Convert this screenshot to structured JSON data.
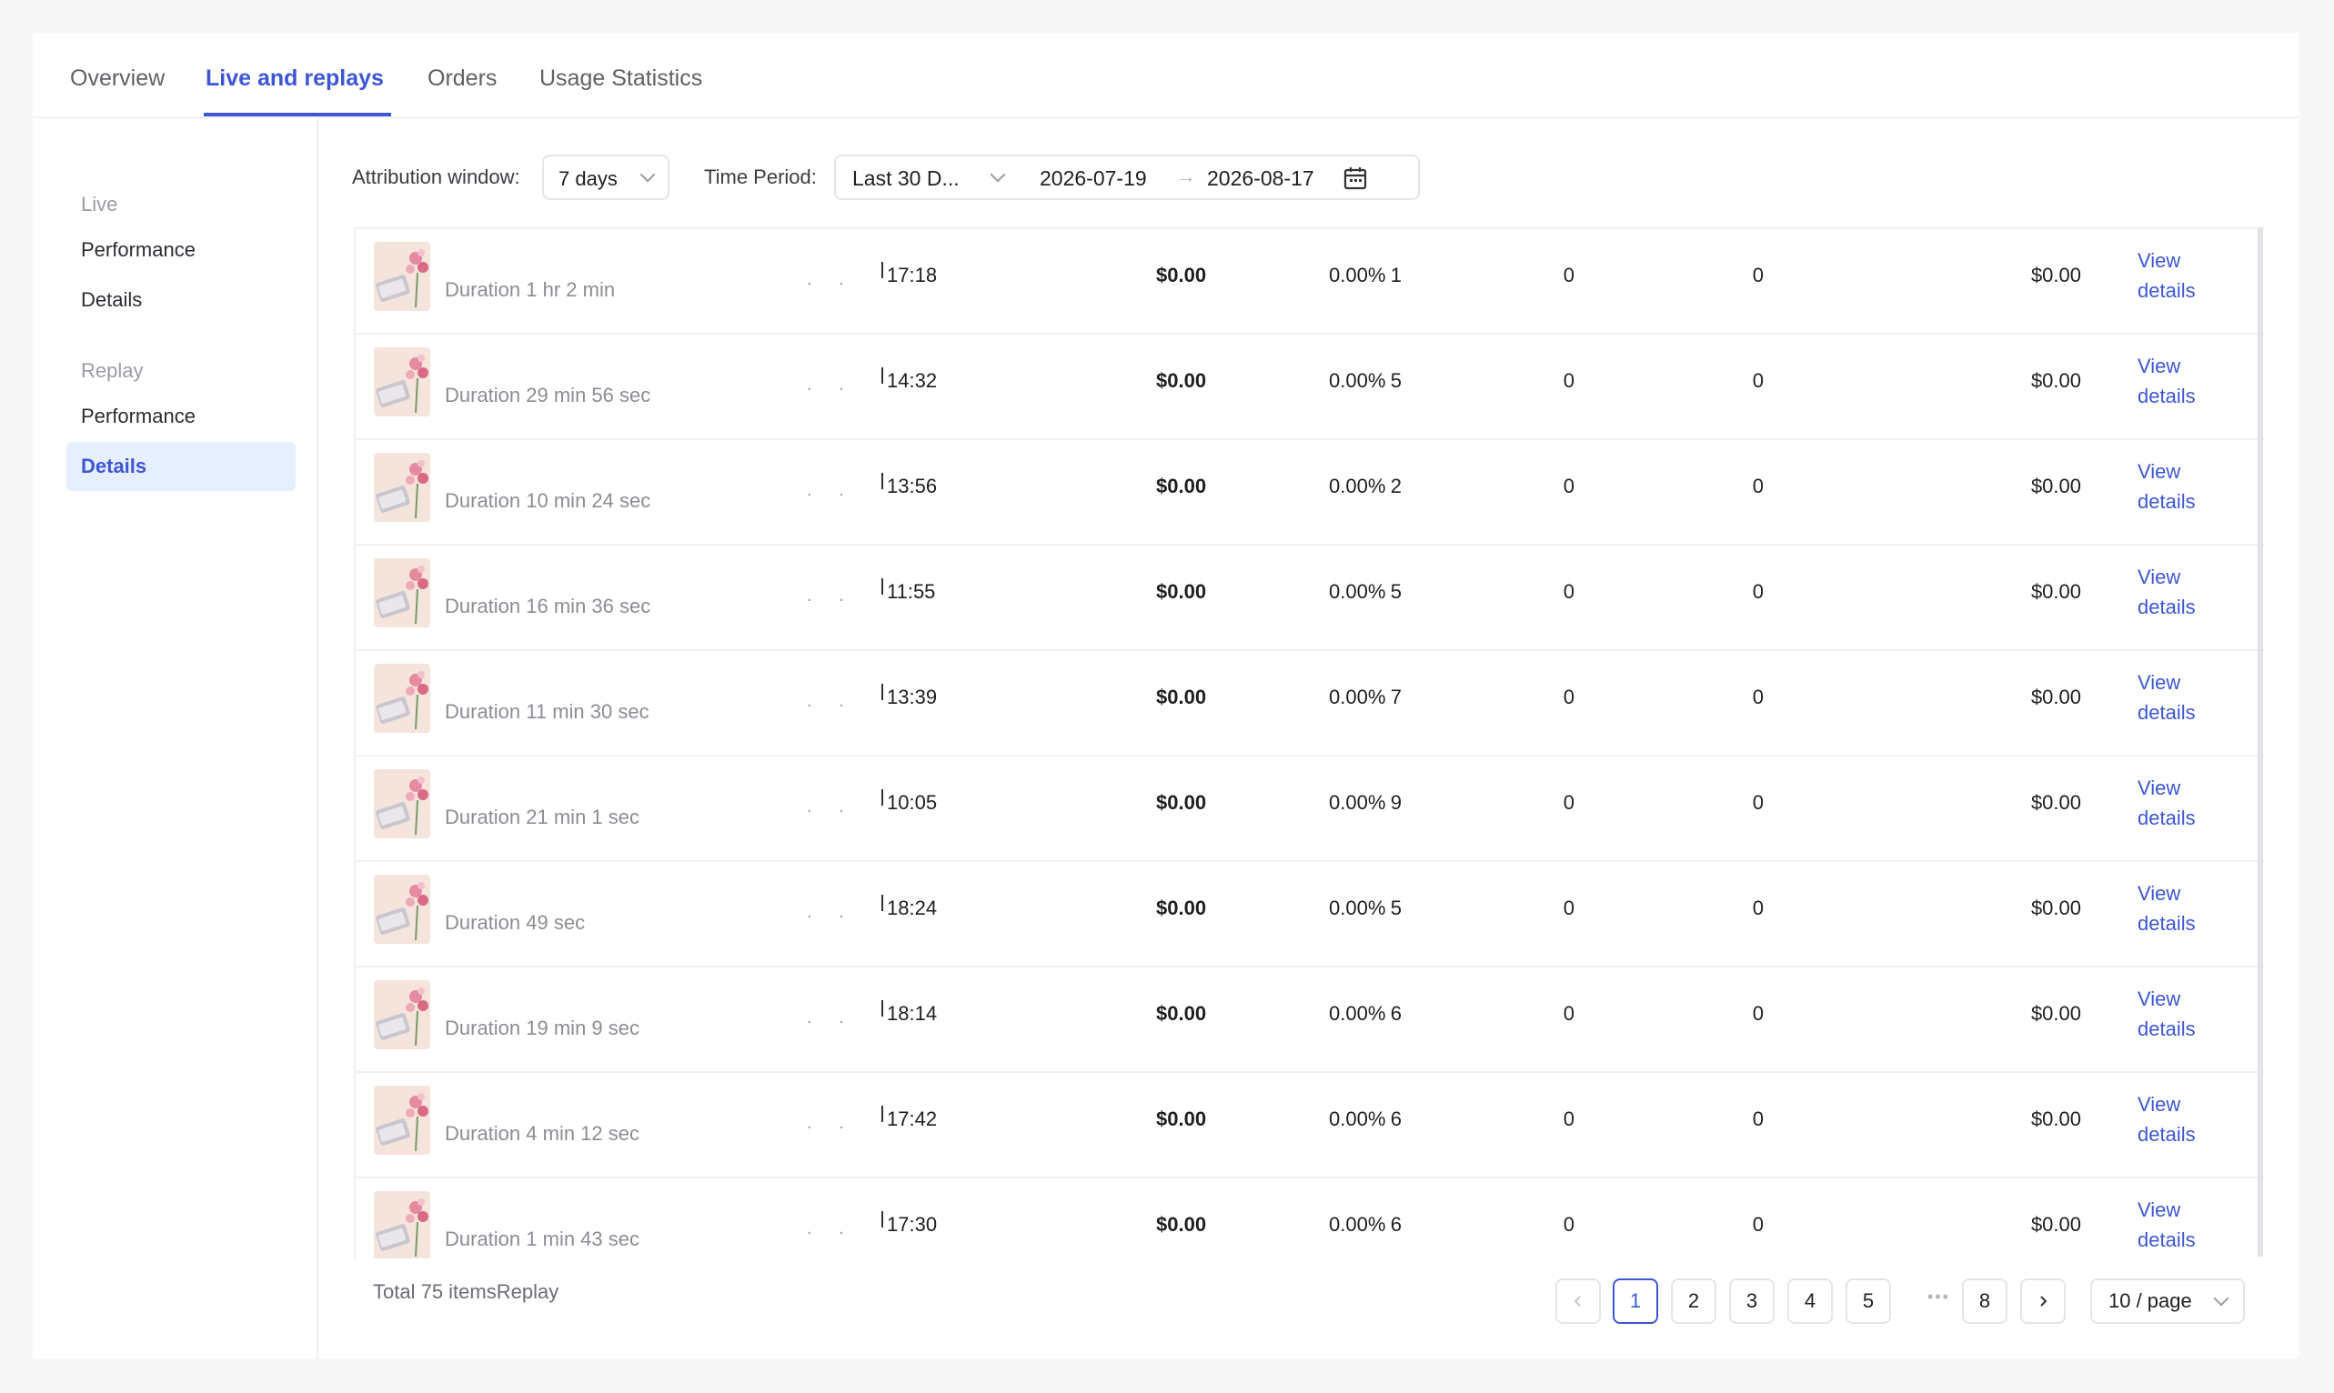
{
  "tabs": [
    "Overview",
    "Live and replays",
    "Orders",
    "Usage Statistics"
  ],
  "sidebar": {
    "live_group": "Live",
    "live_items": [
      "Performance",
      "Details"
    ],
    "replay_group": "Replay",
    "replay_items": [
      "Performance",
      "Details"
    ]
  },
  "filters": {
    "attribution_label": "Attribution window:",
    "attribution_value": "7 days",
    "period_label": "Time Period:",
    "period_value": "Last 30 D...",
    "start_date": "2026-07-19",
    "end_date": "2026-08-17"
  },
  "view_details_label": "View details",
  "rows": [
    {
      "duration": "Duration 1 hr 2 min",
      "time": "17:18",
      "gmv": "$0.00",
      "rate": "0.00%",
      "c1": "1",
      "c2": "0",
      "c3": "0",
      "amount": "$0.00"
    },
    {
      "duration": "Duration 29 min 56 sec",
      "time": "14:32",
      "gmv": "$0.00",
      "rate": "0.00%",
      "c1": "5",
      "c2": "0",
      "c3": "0",
      "amount": "$0.00"
    },
    {
      "duration": "Duration 10 min 24 sec",
      "time": "13:56",
      "gmv": "$0.00",
      "rate": "0.00%",
      "c1": "2",
      "c2": "0",
      "c3": "0",
      "amount": "$0.00"
    },
    {
      "duration": "Duration 16 min 36 sec",
      "time": "11:55",
      "gmv": "$0.00",
      "rate": "0.00%",
      "c1": "5",
      "c2": "0",
      "c3": "0",
      "amount": "$0.00"
    },
    {
      "duration": "Duration 11 min 30 sec",
      "time": "13:39",
      "gmv": "$0.00",
      "rate": "0.00%",
      "c1": "7",
      "c2": "0",
      "c3": "0",
      "amount": "$0.00"
    },
    {
      "duration": "Duration 21 min 1 sec",
      "time": "10:05",
      "gmv": "$0.00",
      "rate": "0.00%",
      "c1": "9",
      "c2": "0",
      "c3": "0",
      "amount": "$0.00"
    },
    {
      "duration": "Duration 49 sec",
      "time": "18:24",
      "gmv": "$0.00",
      "rate": "0.00%",
      "c1": "5",
      "c2": "0",
      "c3": "0",
      "amount": "$0.00"
    },
    {
      "duration": "Duration 19 min 9 sec",
      "time": "18:14",
      "gmv": "$0.00",
      "rate": "0.00%",
      "c1": "6",
      "c2": "0",
      "c3": "0",
      "amount": "$0.00"
    },
    {
      "duration": "Duration 4 min 12 sec",
      "time": "17:42",
      "gmv": "$0.00",
      "rate": "0.00%",
      "c1": "6",
      "c2": "0",
      "c3": "0",
      "amount": "$0.00"
    },
    {
      "duration": "Duration 1 min 43 sec",
      "time": "17:30",
      "gmv": "$0.00",
      "rate": "0.00%",
      "c1": "6",
      "c2": "0",
      "c3": "0",
      "amount": "$0.00"
    }
  ],
  "footer": {
    "total": "Total 75 itemsReplay",
    "pages": [
      "1",
      "2",
      "3",
      "4",
      "5",
      "8"
    ],
    "ellipsis": "•••",
    "current_page": "1",
    "page_size": "10 / page"
  },
  "colors": {
    "accent": "#3d56d6",
    "active_bg": "#e6effd"
  }
}
